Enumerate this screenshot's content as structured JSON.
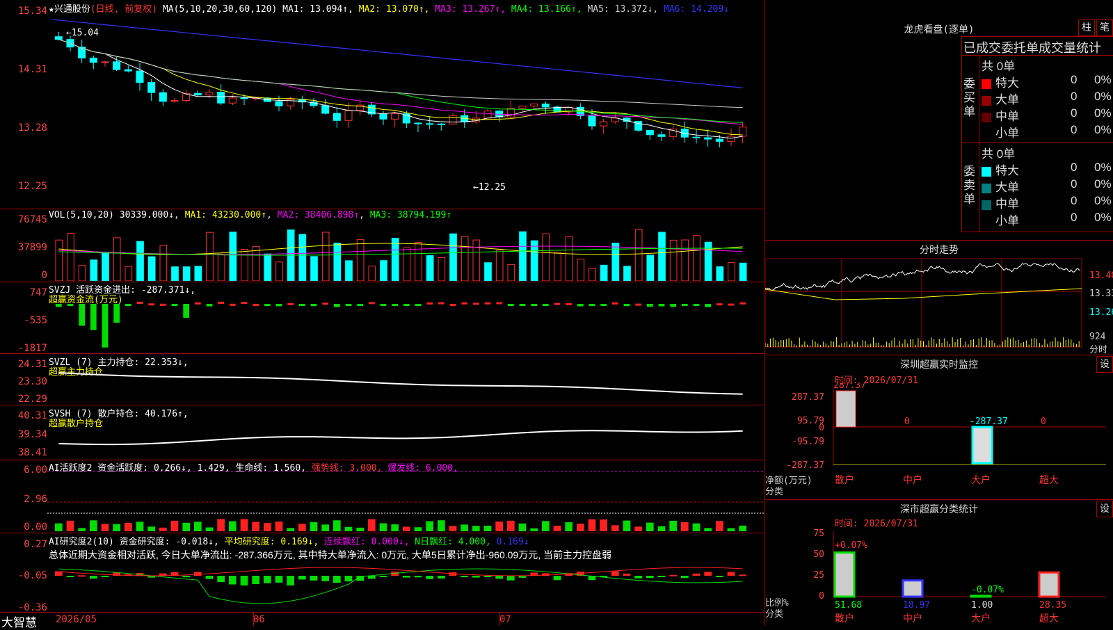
{
  "main": {
    "stock_name": "★兴通股份",
    "mode": "(日线, 前复权)",
    "ma_title": "MA(5,10,20,30,60,120)",
    "ma_values": [
      {
        "label": "MA1: 13.094↑",
        "color": "#ffffff"
      },
      {
        "label": "MA2: 13.070↑",
        "color": "#ffff00"
      },
      {
        "label": "MA3: 13.267↑",
        "color": "#ff00ff"
      },
      {
        "label": "MA4: 13.166↑",
        "color": "#00ff00"
      },
      {
        "label": "MA5: 13.372↓",
        "color": "#cccccc"
      },
      {
        "label": "MA6: 14.209↓",
        "color": "#3333ff"
      }
    ],
    "y_ticks": [
      "15.34",
      "14.31",
      "13.28",
      "12.25"
    ],
    "high_label": "15.04",
    "low_label": "12.25"
  },
  "vol": {
    "title": "VOL(5,10,20)",
    "value": "30339.000↓",
    "ma1": "MA1: 43230.000↑",
    "ma2": "MA2: 38406.898↑",
    "ma3": "MA3: 38794.199↑",
    "y_ticks": [
      "76745",
      "37899",
      "0"
    ]
  },
  "svzj": {
    "title": "SVZJ  活跃资金进出: -287.371↓,",
    "subtitle": "超赢资金流(万元)",
    "y_ticks": [
      "747",
      "-535",
      "-1817"
    ]
  },
  "svzl": {
    "title": "SVZL (7) 主力持仓: 22.353↓,",
    "subtitle": "超赢主力持仓",
    "y_ticks": [
      "24.31",
      "23.30",
      "22.29"
    ]
  },
  "svsh": {
    "title": "SVSH (7) 散户持仓: 40.176↑,",
    "subtitle": "超赢散户持仓",
    "y_ticks": [
      "40.31",
      "39.34",
      "38.41"
    ]
  },
  "ai1": {
    "title": "AI活跃度2 资金活跃度: 0.266↓, 1.429,",
    "life": "生命线: 1.560,",
    "strong": "强势线: 3.000,",
    "burst": "爆发线: 6.000,",
    "y_ticks": [
      "6.00",
      "2.96",
      "0.00"
    ]
  },
  "ai2": {
    "title": "AI研究度2(10) 资金研究度: -0.018↓,",
    "avg": "平均研究度: 0.169↓,",
    "cont": "连续飘红: 0.000↓,",
    "nday": "N日飘红: 4.000,",
    "nval": "0.169↓",
    "summary": "总体近期大资金相对活跃, 今日大单净流出: -287.366万元, 其中特大单净流入: 0万元, 大单5日累计净出-960.09万元, 当前主力控盘弱",
    "y_ticks": [
      "0.27",
      "-0.05",
      "-0.36"
    ]
  },
  "footer": {
    "brand": "大智慧",
    "dates": [
      "2026/05",
      "06",
      "07"
    ]
  },
  "lhb": {
    "title": "龙虎看盘(逐单)",
    "tab_bar": "柱",
    "tab_pen": "笔",
    "heading": "已成交委托单成交量统计",
    "buy_label": "委买单",
    "sell_label": "委卖单",
    "buy_total": "共 0单",
    "sell_total": "共 0单",
    "buy_rows": [
      {
        "name": "特大",
        "val": "0",
        "pct": "0%",
        "color": "#ff0000"
      },
      {
        "name": "大单",
        "val": "0",
        "pct": "0%",
        "color": "#990000"
      },
      {
        "name": "中单",
        "val": "0",
        "pct": "0%",
        "color": "#660000"
      },
      {
        "name": "小单",
        "val": "0",
        "pct": "0%",
        "color": "#000000"
      }
    ],
    "sell_rows": [
      {
        "name": "特大",
        "val": "0",
        "pct": "0%",
        "color": "#00ffff"
      },
      {
        "name": "大单",
        "val": "0",
        "pct": "0%",
        "color": "#008080"
      },
      {
        "name": "中单",
        "val": "0",
        "pct": "0%",
        "color": "#006666"
      },
      {
        "name": "小单",
        "val": "0",
        "pct": "0%",
        "color": "#000000"
      }
    ]
  },
  "intraday": {
    "title": "分时走势",
    "y_ticks": [
      "13.40",
      "13.33",
      "13.26"
    ],
    "vol_tick": "924",
    "vol_label": "分时"
  },
  "sz_monitor": {
    "title": "深圳超赢实时监控",
    "settings": "设",
    "time": "时间: 2026/07/31",
    "y_ticks": [
      "287.37",
      "95.79",
      "0",
      "-95.79",
      "-287.37"
    ],
    "value_labels": [
      "287.37",
      "0",
      "-287.37",
      "0"
    ],
    "axis_title": "净额(万元)",
    "axis_sub": "分类",
    "categories": [
      "散户",
      "中户",
      "大户",
      "超大"
    ],
    "values": [
      287.37,
      0,
      -287.37,
      0
    ]
  },
  "sz_class": {
    "title": "深市超赢分类统计",
    "settings": "设",
    "time": "时间: 2026/07/31",
    "y_ticks": [
      "75",
      "50",
      "25",
      "0"
    ],
    "pct_labels": [
      "+0.07%",
      "-0.07%"
    ],
    "bottom_values": [
      "51.68",
      "18.97",
      "1.00",
      "28.35"
    ],
    "axis_title": "比例%",
    "axis_sub": "分类",
    "categories": [
      "散户",
      "中户",
      "大户",
      "超大"
    ],
    "values": [
      51.68,
      18.97,
      1.0,
      28.35
    ]
  }
}
